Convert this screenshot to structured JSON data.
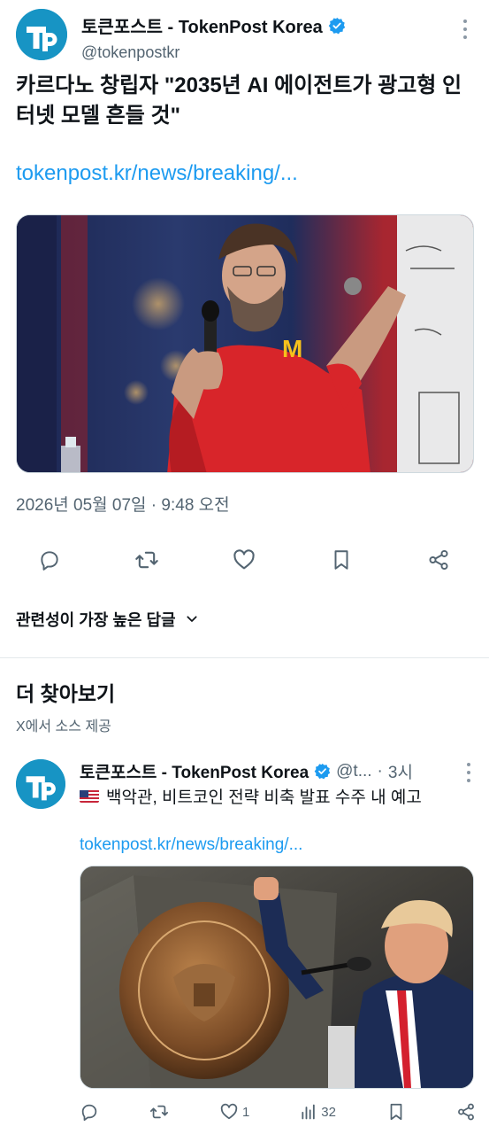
{
  "tweet": {
    "author_name": "토큰포스트 - TokenPost Korea",
    "author_handle": "@tokenpostkr",
    "text": "카르다노 창립자 \"2035년 AI 에이전트가 광고형 인터넷 모델 흔들 것\"",
    "link": "tokenpost.kr/news/breaking/...",
    "timestamp": "2026년 05월 07일 · 9:48 오전",
    "media_caption": ""
  },
  "actions": {
    "reply_icon": "reply-icon",
    "retweet_icon": "retweet-icon",
    "like_icon": "heart-icon",
    "bookmark_icon": "bookmark-icon",
    "share_icon": "share-icon"
  },
  "replies_sort": {
    "label": "관련성이 가장 높은 답글"
  },
  "more_section": {
    "title": "더 찾아보기",
    "subtitle": "X에서 소스 제공"
  },
  "related_tweet": {
    "author_name": "토큰포스트 - TokenPost Korea",
    "author_handle": "@t...",
    "separator": "·",
    "time": "3시",
    "flag": "🇺🇸",
    "text": "백악관, 비트코인 전략 비축 발표 수주 내 예고",
    "link": "tokenpost.kr/news/breaking/...",
    "likes": "1",
    "views": "32"
  },
  "colors": {
    "accent": "#1d9bf0",
    "avatar_bg": "#1794c4",
    "text_secondary": "#536471"
  }
}
